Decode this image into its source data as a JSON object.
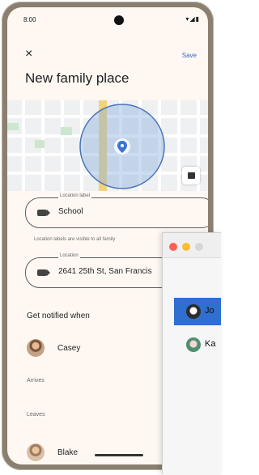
{
  "status": {
    "time": "8:00",
    "icons": "▾◢▮"
  },
  "header": {
    "close_icon": "×",
    "save_label": "Save",
    "title": "New family place"
  },
  "form": {
    "label_field": {
      "label": "Location label",
      "value": "School"
    },
    "helper_text": "Location labels are visible to all family",
    "address_field": {
      "label": "Location",
      "value": "2641 25th St, San Francis"
    }
  },
  "notifications": {
    "heading": "Get notified when",
    "people": [
      {
        "name": "Casey"
      },
      {
        "name": "Blake"
      }
    ],
    "arrives_label": "Arrives",
    "leaves_label": "Leaves"
  },
  "overlay_window": {
    "contacts": [
      {
        "name": "Jo",
        "selected": true
      },
      {
        "name": "Ka",
        "selected": false
      }
    ]
  },
  "colors": {
    "accent": "#2f66c9",
    "selected_contact": "#2f6fcf",
    "geofence_fill": "#8fb1df",
    "geofence_stroke": "#4b74b9",
    "road_yellow": "#f2d37a"
  },
  "icons": {
    "layers": "layers-icon",
    "label": "label-icon",
    "close": "close-icon"
  }
}
